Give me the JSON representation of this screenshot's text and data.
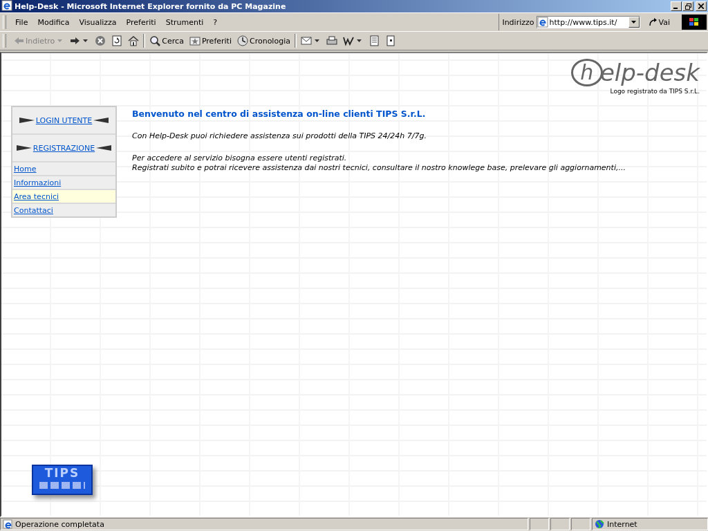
{
  "window": {
    "title": "Help-Desk - Microsoft Internet Explorer fornito da PC Magazine"
  },
  "menu": [
    "File",
    "Modifica",
    "Visualizza",
    "Preferiti",
    "Strumenti",
    "?"
  ],
  "address": {
    "label": "Indirizzo",
    "value": "http://www.tips.it/",
    "go": "Vai"
  },
  "toolbar": [
    {
      "kind": "back",
      "label": "Indietro",
      "disabled": true,
      "dropdown": true
    },
    {
      "kind": "forward",
      "dropdown": true
    },
    {
      "kind": "stop"
    },
    {
      "kind": "refresh"
    },
    {
      "kind": "home"
    },
    {
      "kind": "search",
      "label": "Cerca"
    },
    {
      "kind": "favorites",
      "label": "Preferiti"
    },
    {
      "kind": "history",
      "label": "Cronologia"
    },
    {
      "kind": "mail",
      "dropdown": true
    },
    {
      "kind": "print"
    },
    {
      "kind": "edit",
      "dropdown": true
    },
    {
      "kind": "discuss"
    },
    {
      "kind": "messenger"
    }
  ],
  "page": {
    "logo": {
      "initial": "h",
      "rest": "elp-desk",
      "caption": "Logo registrato da TIPS S.r.L."
    },
    "sidebar": [
      {
        "kind": "arrow",
        "label": "LOGIN UTENTE",
        "selected": false
      },
      {
        "kind": "arrow",
        "label": "REGISTRAZIONE",
        "selected": false
      },
      {
        "kind": "link",
        "label": "Home",
        "selected": false
      },
      {
        "kind": "link",
        "label": "Informazioni",
        "selected": false
      },
      {
        "kind": "link",
        "label": "Area tecnici",
        "selected": true
      },
      {
        "kind": "link",
        "label": "Contattaci",
        "selected": false
      }
    ],
    "heading": "Benvenuto nel centro di assistenza on-line clienti TIPS S.r.L.",
    "paragraphs": [
      [
        "Con Help-Desk puoi richiedere assistenza sui prodotti della TIPS 24/24h 7/7g."
      ],
      [
        "Per accedere al servizio bisogna essere utenti registrati.",
        "Registrati subito e potrai ricevere assistenza dai nostri tecnici, consultare il nostro knowlege base, prelevare gli aggiornamenti,..."
      ]
    ],
    "footer_logo": "TIPS"
  },
  "status_bar": {
    "text": "Operazione completata",
    "zone": "Internet"
  }
}
